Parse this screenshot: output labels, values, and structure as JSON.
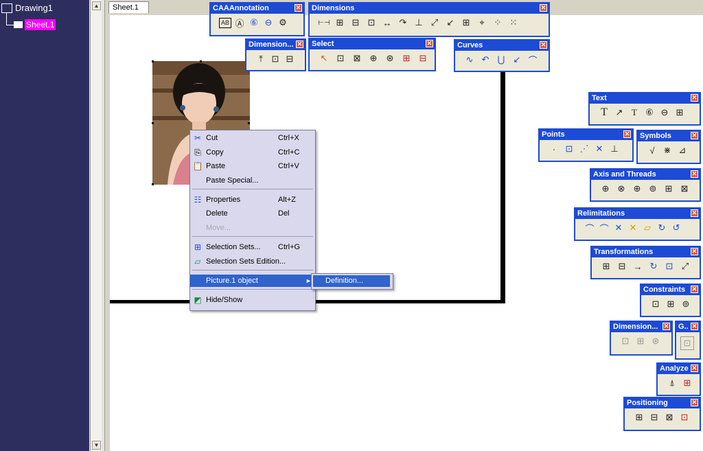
{
  "tree": {
    "root": "Drawing1",
    "sheet": "Sheet.1"
  },
  "tab": {
    "label": "Sheet.1"
  },
  "context_menu": {
    "items": [
      {
        "label": "Cut",
        "shortcut": "Ctrl+X",
        "icon": "scissors-icon",
        "disabled": false
      },
      {
        "label": "Copy",
        "shortcut": "Ctrl+C",
        "icon": "copy-icon",
        "disabled": false
      },
      {
        "label": "Paste",
        "shortcut": "Ctrl+V",
        "icon": "paste-icon",
        "disabled": false
      },
      {
        "label": "Paste Special...",
        "shortcut": "",
        "icon": "",
        "disabled": false
      },
      {
        "label": "Properties",
        "shortcut": "Alt+Z",
        "icon": "properties-icon",
        "disabled": false
      },
      {
        "label": "Delete",
        "shortcut": "Del",
        "icon": "",
        "disabled": false
      },
      {
        "label": "Move...",
        "shortcut": "",
        "icon": "",
        "disabled": true
      },
      {
        "label": "Selection Sets...",
        "shortcut": "Ctrl+G",
        "icon": "selection-sets-icon",
        "disabled": false
      },
      {
        "label": "Selection Sets Edition...",
        "shortcut": "",
        "icon": "selection-sets-edition-icon",
        "disabled": false
      },
      {
        "label": "Picture.1 object",
        "shortcut": "",
        "icon": "",
        "disabled": false
      },
      {
        "label": "Hide/Show",
        "shortcut": "",
        "icon": "hide-show-icon",
        "disabled": false
      }
    ],
    "submenu": {
      "label": "Definition..."
    }
  },
  "toolbars": {
    "caaannotation": {
      "title": "CAAAnnotation",
      "icons": [
        "AB",
        "Ⓐ",
        "⑥",
        "⊖",
        "⚙"
      ]
    },
    "dimensions": {
      "title": "Dimensions",
      "icons": [
        "⊢⊣",
        "⊞",
        "⊟",
        "⊡",
        "↔",
        "↷",
        "⊥",
        "⤢",
        "↙",
        "⊞",
        "⌖",
        "⁘",
        "⁙"
      ]
    },
    "dimension_small": {
      "title": "Dimension...",
      "icons": [
        "⤒",
        "⊡",
        "⊟"
      ]
    },
    "select": {
      "title": "Select",
      "icons": [
        "↖",
        "⊡",
        "⊠",
        "⊕",
        "⊛",
        "⊞",
        "⊟"
      ]
    },
    "curves": {
      "title": "Curves",
      "icons": [
        "∿",
        "↶",
        "⋃",
        "↙",
        "⌒"
      ]
    },
    "text": {
      "title": "Text",
      "icons": [
        "T",
        "↗",
        "T",
        "⑥",
        "⊖",
        "⊞"
      ]
    },
    "points": {
      "title": "Points",
      "icons": [
        "·",
        "⊡",
        "⋰",
        "✕",
        "⊥"
      ]
    },
    "symbols": {
      "title": "Symbols",
      "icons": [
        "√",
        "⋇",
        "⊿"
      ]
    },
    "axis_threads": {
      "title": "Axis and Threads",
      "icons": [
        "⊕",
        "⊗",
        "⊕",
        "⊚",
        "⊞",
        "⊠"
      ]
    },
    "relimitations": {
      "title": "Relimitations",
      "icons": [
        "⌒",
        "⌒",
        "✕",
        "✕",
        "▱",
        "↻",
        "↺"
      ]
    },
    "transformations": {
      "title": "Transformations",
      "icons": [
        "⊞",
        "⊟",
        "→",
        "↻",
        "⊡",
        "⤢"
      ]
    },
    "constraints": {
      "title": "Constraints",
      "icons": [
        "⊡",
        "⊞",
        "⊚"
      ]
    },
    "dimension2": {
      "title": "Dimension...",
      "icons": [
        "⊡",
        "⊞",
        "⊛"
      ]
    },
    "g": {
      "title": "G..",
      "icons": [
        "⊡"
      ]
    },
    "analyze": {
      "title": "Analyze",
      "icons": [
        "⍋",
        "⊞"
      ]
    },
    "positioning": {
      "title": "Positioning",
      "icons": [
        "⊞",
        "⊟",
        "⊠",
        "⊡"
      ]
    }
  }
}
